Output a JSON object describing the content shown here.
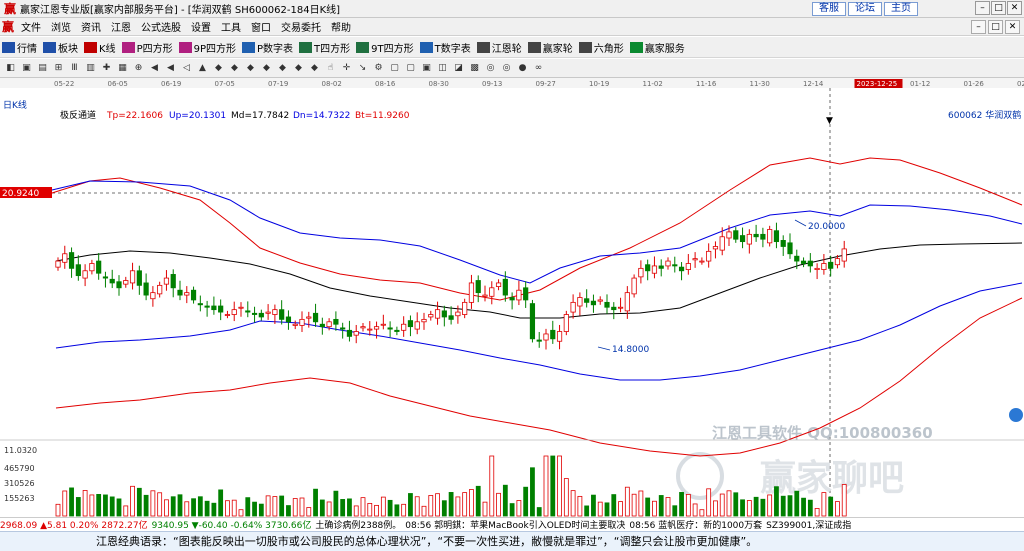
{
  "window": {
    "title": "赢家江恩专业版[赢家内部服务平台] - [华润双鹤 SH600062-184日K线]",
    "links": [
      "客服",
      "论坛",
      "主页"
    ],
    "controls": [
      "–",
      "□",
      "✕"
    ]
  },
  "menu": {
    "items": [
      "文件",
      "浏览",
      "资讯",
      "江恩",
      "公式选股",
      "设置",
      "工具",
      "窗口",
      "交易委托",
      "帮助"
    ],
    "right_controls": [
      "–",
      "□",
      "✕"
    ]
  },
  "toolbar1": {
    "items": [
      {
        "label": "行情",
        "icon": "grid-icon",
        "color": "#1f4fa8"
      },
      {
        "label": "板块",
        "icon": "grid-icon",
        "color": "#1f4fa8"
      },
      {
        "label": "K线",
        "icon": "candle-icon",
        "color": "#c00000"
      },
      {
        "label": "P四方形",
        "icon": "square-icon",
        "color": "#b02080"
      },
      {
        "label": "9P四方形",
        "icon": "square-icon",
        "color": "#b02080"
      },
      {
        "label": "P数字表",
        "icon": "table-icon",
        "color": "#2060b0"
      },
      {
        "label": "T四方形",
        "icon": "square-icon",
        "color": "#207040"
      },
      {
        "label": "9T四方形",
        "icon": "square-icon",
        "color": "#207040"
      },
      {
        "label": "T数字表",
        "icon": "table-icon",
        "color": "#2060b0"
      },
      {
        "label": "江恩轮",
        "icon": "wheel-icon",
        "color": "#444"
      },
      {
        "label": "赢家轮",
        "icon": "wheel-icon",
        "color": "#444"
      },
      {
        "label": "六角形",
        "icon": "hexagon-icon",
        "color": "#444"
      },
      {
        "label": "赢家服务",
        "icon": "dollar-icon",
        "color": "#0a8a30"
      }
    ]
  },
  "toolbar2": {
    "icons": [
      "◧",
      "▣",
      "▤",
      "⊞",
      "Ⅲ",
      "▥",
      "✚",
      "▦",
      "⊕",
      "◀",
      "◀",
      "◁",
      "▲",
      "◆",
      "◆",
      "◆",
      "◆",
      "◆",
      "◆",
      "◆",
      "☝",
      "✛",
      "↘",
      "⚙",
      "▢",
      "▢",
      "▣",
      "◫",
      "◪",
      "▩",
      "◎",
      "◎",
      "●",
      "∞"
    ]
  },
  "chart": {
    "period_label": "日K线",
    "date_ticks": [
      "05-22",
      "06-05",
      "06-19",
      "07-05",
      "07-19",
      "08-02",
      "08-16",
      "08-30",
      "09-13",
      "09-27",
      "10-19",
      "11-02",
      "11-16",
      "11-30",
      "12-14",
      "2023-12-25",
      "01-12",
      "01-26",
      "02-09"
    ],
    "indicator_name": "极反通道",
    "indicator_values": [
      {
        "label": "Tp=22.1606",
        "color": "#e00000"
      },
      {
        "label": "Up=20.1301",
        "color": "#0000e0"
      },
      {
        "label": "Md=17.7842",
        "color": "#000000"
      },
      {
        "label": "Dn=14.7322",
        "color": "#0000e0"
      },
      {
        "label": "Bt=11.9260",
        "color": "#e00000"
      }
    ],
    "stock_label": "600062 华润双鹤",
    "price_label": "20.9240",
    "high_marker": "20.0000",
    "low_marker": "14.8000",
    "volume_scale": [
      "11.0320",
      "465790",
      "310526",
      "155263"
    ],
    "watermark1": "江恩工具软件 QQ:100800360",
    "watermark2": "赢家聊吧",
    "colors": {
      "up": "#e00000",
      "down": "#008000",
      "band_outer": "#e00000",
      "band_inner": "#0000e0",
      "mid": "#000000"
    },
    "chart_data": {
      "type": "candlestick",
      "price_min": 11.0,
      "price_max": 24.5,
      "closes": [
        18.2,
        18.5,
        17.9,
        17.6,
        17.8,
        18.1,
        17.7,
        17.5,
        17.3,
        17.1,
        17.4,
        17.8,
        17.2,
        16.8,
        16.9,
        17.2,
        17.5,
        17.1,
        16.8,
        16.9,
        16.6,
        16.4,
        16.3,
        16.2,
        16.1,
        16.0,
        16.2,
        16.3,
        16.1,
        16.0,
        15.9,
        16.1,
        16.2,
        15.8,
        15.7,
        15.6,
        15.8,
        15.9,
        15.7,
        15.5,
        15.7,
        15.6,
        15.4,
        15.1,
        15.3,
        15.5,
        15.4,
        15.5,
        15.6,
        15.4,
        15.3,
        15.6,
        15.5,
        15.7,
        15.8,
        16.0,
        16.2,
        15.9,
        15.8,
        16.1,
        16.5,
        17.3,
        16.9,
        16.8,
        17.1,
        17.3,
        16.8,
        16.6,
        17.0,
        16.6,
        15.0,
        14.9,
        15.2,
        15.0,
        15.3,
        16.0,
        16.5,
        16.7,
        16.5,
        16.4,
        16.6,
        16.3,
        16.2,
        16.3,
        16.9,
        17.5,
        17.9,
        17.8,
        18.0,
        17.9,
        18.2,
        18.0,
        17.8,
        18.1,
        18.3,
        18.2,
        18.6,
        18.8,
        19.2,
        19.4,
        19.1,
        19.0,
        19.3,
        19.2,
        19.1,
        19.5,
        19.0,
        18.8,
        18.5,
        18.2,
        18.1,
        18.0,
        17.9,
        18.1,
        17.9,
        18.3,
        18.7
      ]
    }
  },
  "ind_bar": {
    "items": [
      {
        "text": "2968.09 ▲5.81 0.20% 2872.27亿",
        "color": "#d00"
      },
      {
        "text": "9340.95 ▼-60.40 -0.64% 3730.66亿",
        "color": "#008000"
      },
      {
        "text": "土确诊病例2388例。",
        "color": "#000"
      },
      {
        "text": "08:56 郭明錤：苹果MacBook引入OLED时间主要取决",
        "color": "#000"
      },
      {
        "text": "08:56 蓝帆医疗：新的1000万套",
        "color": "#000"
      },
      {
        "text": "SZ399001,深证成指",
        "color": "#000"
      }
    ]
  },
  "quote": {
    "text": "江恩经典语录：“图表能反映出一切股市或公司股民的总体心理状况”，“不要一次性买进，敝慢就是罪过”，“调整只会让股市更加健康”。"
  }
}
